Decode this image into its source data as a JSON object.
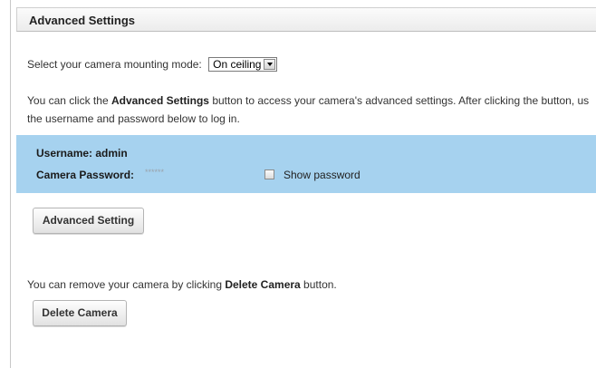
{
  "panel": {
    "title": "Advanced Settings"
  },
  "mounting": {
    "label": "Select your camera mounting mode:",
    "selected": "On ceiling"
  },
  "instructions": {
    "part1": "You can click the ",
    "bold": "Advanced Settings",
    "part2": " button to access your camera's advanced settings. After clicking the button, us",
    "line2": "the username and password below to log in."
  },
  "credentials": {
    "username_label": "Username:",
    "username_value": "admin",
    "password_label": "Camera Password:",
    "password_mask": "******",
    "show_password_label": "Show password",
    "show_password_checked": false
  },
  "buttons": {
    "advanced_setting": "Advanced Setting",
    "delete_camera": "Delete Camera"
  },
  "remove": {
    "part1": "You can remove your camera by clicking ",
    "bold": "Delete Camera",
    "part2": " button."
  },
  "colors": {
    "credentials_bg": "#a6d2ef",
    "header_bg": "#efefef"
  }
}
